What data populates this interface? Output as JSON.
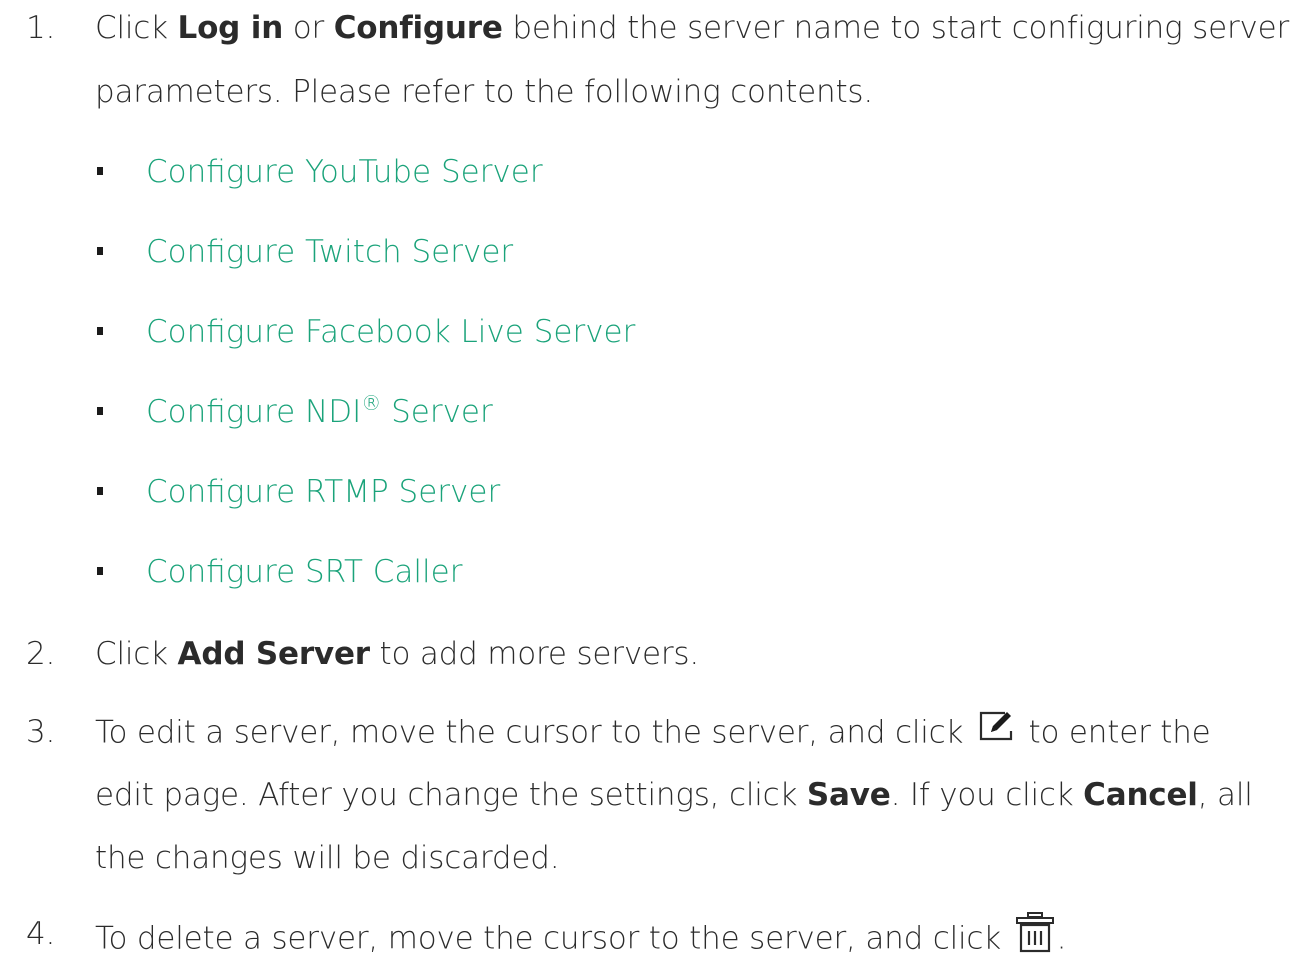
{
  "steps": [
    {
      "number": "1.",
      "line1": {
        "pre": "Click ",
        "bold1": "Log in",
        "mid": " or ",
        "bold2": "Configure",
        "post": " behind the server name to start configuring server"
      },
      "line2": "parameters. Please refer to the following contents.",
      "links": [
        {
          "label": "Configure YouTube Server"
        },
        {
          "label": "Configure Twitch Server"
        },
        {
          "label": "Configure Facebook Live Server"
        },
        {
          "label_pre": "Configure NDI",
          "label_sup": "®",
          "label_post": " Server"
        },
        {
          "label": "Configure RTMP Server"
        },
        {
          "label": "Configure SRT Caller"
        }
      ]
    },
    {
      "number": "2.",
      "pre": "Click ",
      "bold": "Add Server",
      "post": " to add more servers."
    },
    {
      "number": "3.",
      "line1_pre": "To edit a server, move the cursor to the server, and click ",
      "line1_icon": "edit-icon",
      "line1_post": " to enter the",
      "line2_pre": "edit page. After you change the settings, click ",
      "line2_bold1": "Save",
      "line2_mid": ". If you click ",
      "line2_bold2": "Cancel",
      "line2_post": ", all",
      "line3": "the changes will be discarded."
    },
    {
      "number": "4.",
      "pre": "To delete a server, move the cursor to the server, and click ",
      "icon": "trash-icon",
      "post": "."
    }
  ],
  "colors": {
    "text": "#2b2b2b",
    "link": "#1aa37a"
  }
}
